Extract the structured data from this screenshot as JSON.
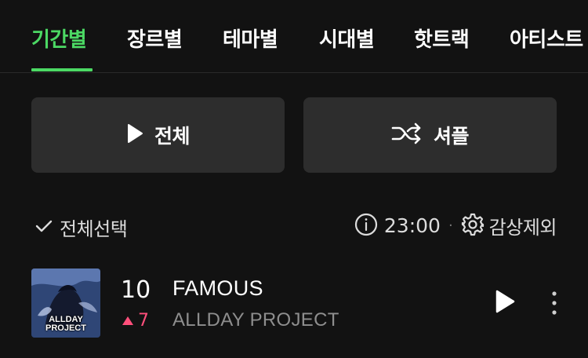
{
  "tabs": [
    {
      "label": "기간별",
      "active": true
    },
    {
      "label": "장르별",
      "active": false
    },
    {
      "label": "테마별",
      "active": false
    },
    {
      "label": "시대별",
      "active": false
    },
    {
      "label": "핫트랙",
      "active": false
    },
    {
      "label": "아티스트",
      "active": false
    }
  ],
  "actions": {
    "play_all_label": "전체",
    "play_all_icon": "play-icon",
    "shuffle_label": "셔플",
    "shuffle_icon": "shuffle-icon"
  },
  "list_controls": {
    "select_all_label": "전체선택",
    "duration": "23:00",
    "separator": "·",
    "exclude_label": "감상제외"
  },
  "tracks": [
    {
      "rank": "10",
      "change": "7",
      "change_direction": "up",
      "title": "FAMOUS",
      "artist": "ALLDAY PROJECT",
      "cover_text": "ALLDAY PROJECT"
    }
  ],
  "colors": {
    "accent": "#4cd964",
    "background": "#121212",
    "button_bg": "#2d2d2d",
    "rank_up": "#ff4f7b",
    "secondary_text": "#8e8e8e"
  }
}
